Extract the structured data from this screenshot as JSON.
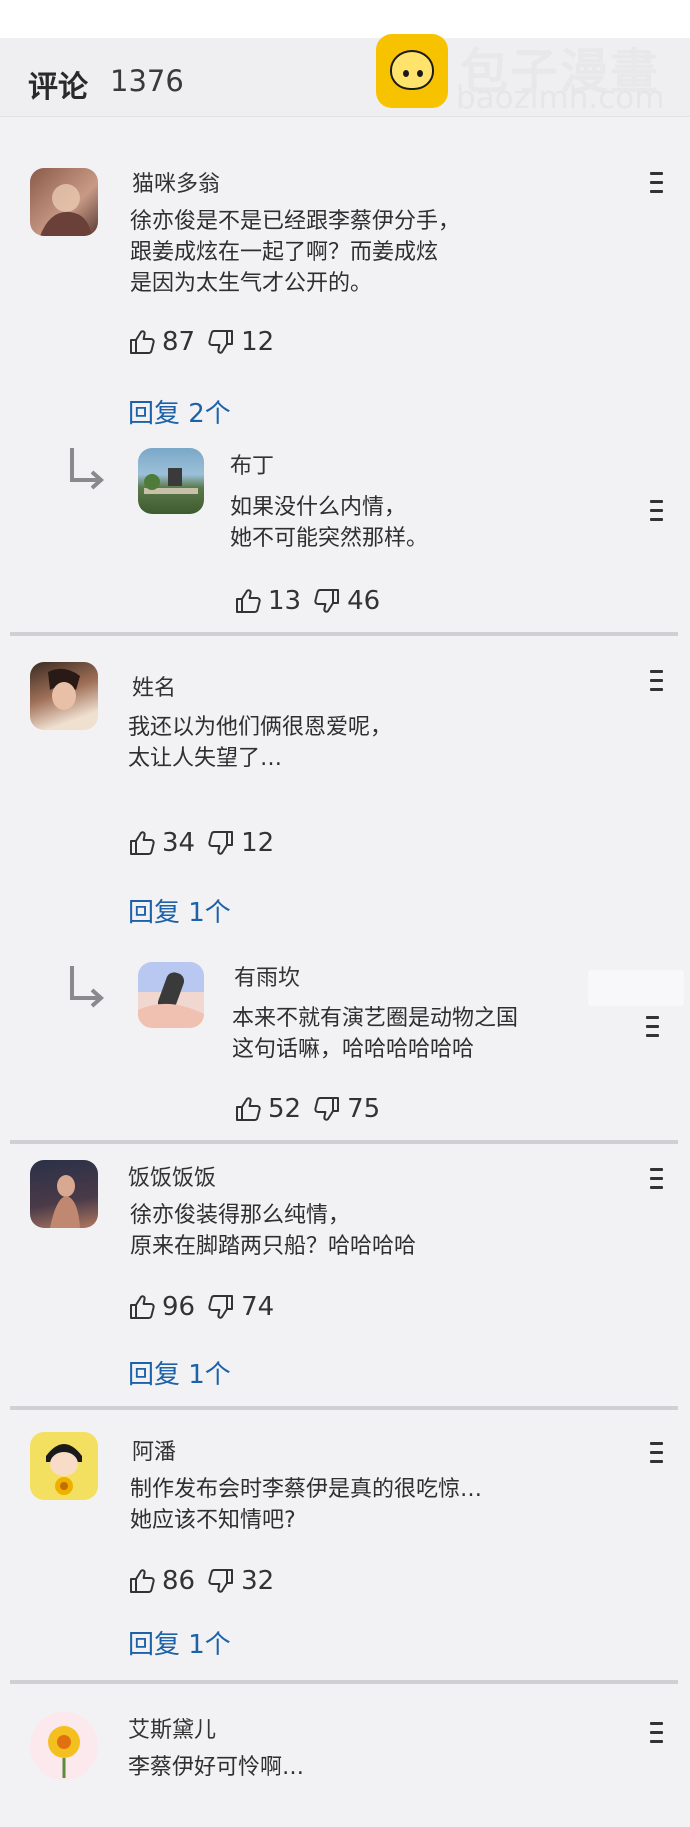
{
  "header": {
    "title": "评论",
    "count": "1376"
  },
  "watermark": {
    "logo_text": "包子漫畫",
    "domain": "baozimh.com",
    "accent": "#f7c300"
  },
  "colors": {
    "link": "#1d62a8",
    "divider": "#d0d0d4",
    "background": "#f2f2f4"
  },
  "icons": {
    "like": "thumbs-up-icon",
    "dislike": "thumbs-down-icon",
    "menu": "more-menu-icon",
    "reply_arrow": "reply-arrow-icon"
  },
  "comments": [
    {
      "user": "猫咪多翁",
      "text": "徐亦俊是不是已经跟李蔡伊分手，\n跟姜成炫在一起了啊？而姜成炫\n是因为太生气才公开的。",
      "likes": "87",
      "dislikes": "12",
      "reply_label": "回复 2个",
      "reply": {
        "user": "布丁",
        "text": "如果没什么内情，\n她不可能突然那样。",
        "likes": "13",
        "dislikes": "46"
      }
    },
    {
      "user": "姓名",
      "text": "我还以为他们俩很恩爱呢，\n太让人失望了…",
      "likes": "34",
      "dislikes": "12",
      "reply_label": "回复 1个",
      "reply": {
        "user": "有雨坎",
        "text": "本来不就有演艺圈是动物之国\n这句话嘛，哈哈哈哈哈哈",
        "likes": "52",
        "dislikes": "75"
      }
    },
    {
      "user": "饭饭饭饭",
      "text": "徐亦俊装得那么纯情，\n原来在脚踏两只船？哈哈哈哈",
      "likes": "96",
      "dislikes": "74",
      "reply_label": "回复 1个"
    },
    {
      "user": "阿潘",
      "text": "制作发布会时李蔡伊是真的很吃惊…\n她应该不知情吧?",
      "likes": "86",
      "dislikes": "32",
      "reply_label": "回复 1个"
    },
    {
      "user": "艾斯黛儿",
      "text": "李蔡伊好可怜啊…"
    }
  ]
}
